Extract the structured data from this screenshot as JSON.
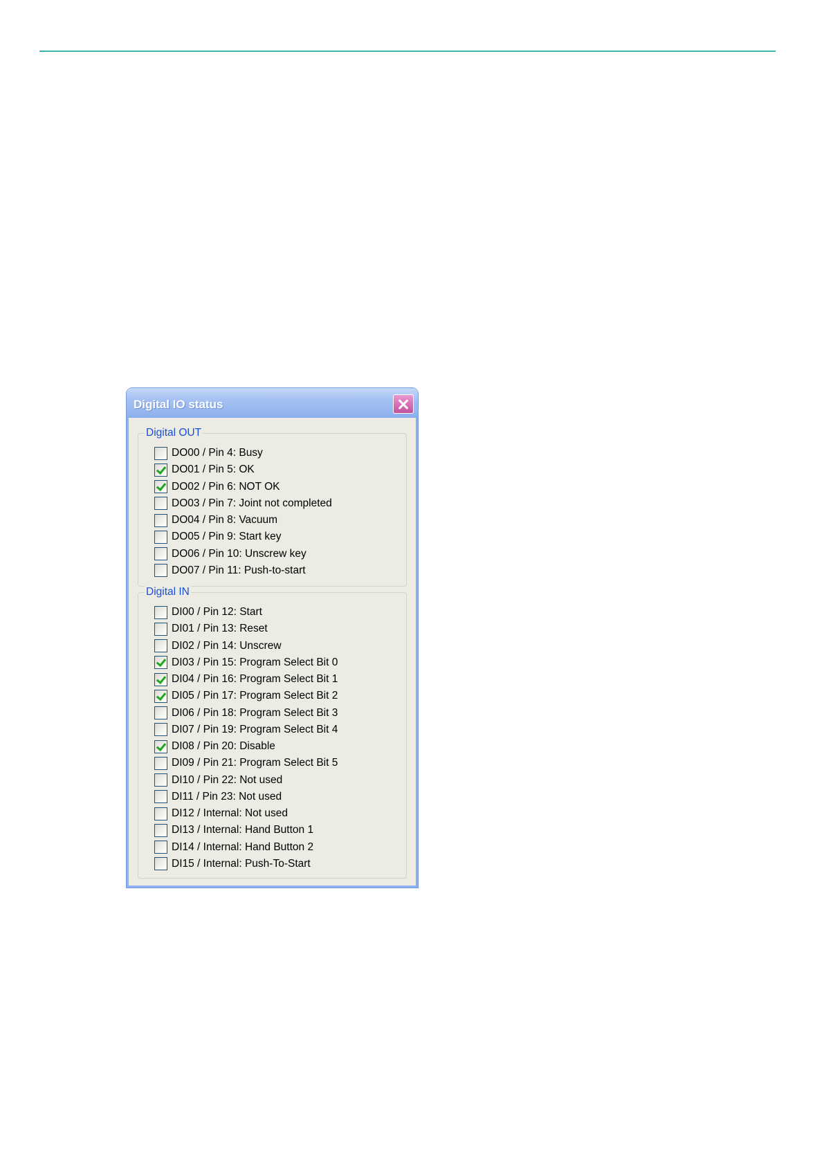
{
  "dialog": {
    "title": "Digital IO status",
    "close_button_icon": "close-icon"
  },
  "groups": [
    {
      "label": "Digital OUT",
      "items": [
        {
          "label": "DO00 / Pin 4: Busy",
          "checked": false
        },
        {
          "label": "DO01 / Pin 5: OK",
          "checked": true
        },
        {
          "label": "DO02 / Pin 6: NOT OK",
          "checked": true
        },
        {
          "label": "DO03 / Pin 7: Joint not completed",
          "checked": false
        },
        {
          "label": "DO04 / Pin 8: Vacuum",
          "checked": false
        },
        {
          "label": "DO05 / Pin 9: Start key",
          "checked": false
        },
        {
          "label": "DO06 / Pin 10: Unscrew key",
          "checked": false
        },
        {
          "label": "DO07 / Pin 11: Push-to-start",
          "checked": false
        }
      ]
    },
    {
      "label": "Digital IN",
      "items": [
        {
          "label": "DI00 / Pin 12: Start",
          "checked": false
        },
        {
          "label": "DI01 / Pin 13: Reset",
          "checked": false
        },
        {
          "label": "DI02 / Pin 14: Unscrew",
          "checked": false
        },
        {
          "label": "DI03 / Pin 15: Program Select Bit 0",
          "checked": true
        },
        {
          "label": "DI04 / Pin 16: Program Select Bit 1",
          "checked": true
        },
        {
          "label": "DI05 / Pin 17: Program Select Bit 2",
          "checked": true
        },
        {
          "label": "DI06 / Pin 18: Program Select Bit 3",
          "checked": false
        },
        {
          "label": "DI07 / Pin 19: Program Select Bit 4",
          "checked": false
        },
        {
          "label": "DI08 / Pin 20: Disable",
          "checked": true
        },
        {
          "label": "DI09 / Pin 21: Program Select Bit 5",
          "checked": false
        },
        {
          "label": "DI10 / Pin 22: Not used",
          "checked": false
        },
        {
          "label": "DI11 / Pin 23: Not used",
          "checked": false
        },
        {
          "label": "DI12 / Internal: Not used",
          "checked": false
        },
        {
          "label": "DI13 / Internal: Hand Button 1",
          "checked": false
        },
        {
          "label": "DI14 / Internal: Hand Button 2",
          "checked": false
        },
        {
          "label": "DI15 / Internal: Push-To-Start",
          "checked": false
        }
      ]
    }
  ],
  "colors": {
    "rule": "#3cb5aa",
    "title_bar": "#9dbcf0",
    "close_button": "#d46ab2",
    "group_label": "#1b4fcf",
    "check_mark": "#22a322",
    "dialog_body": "#ecebe4"
  }
}
